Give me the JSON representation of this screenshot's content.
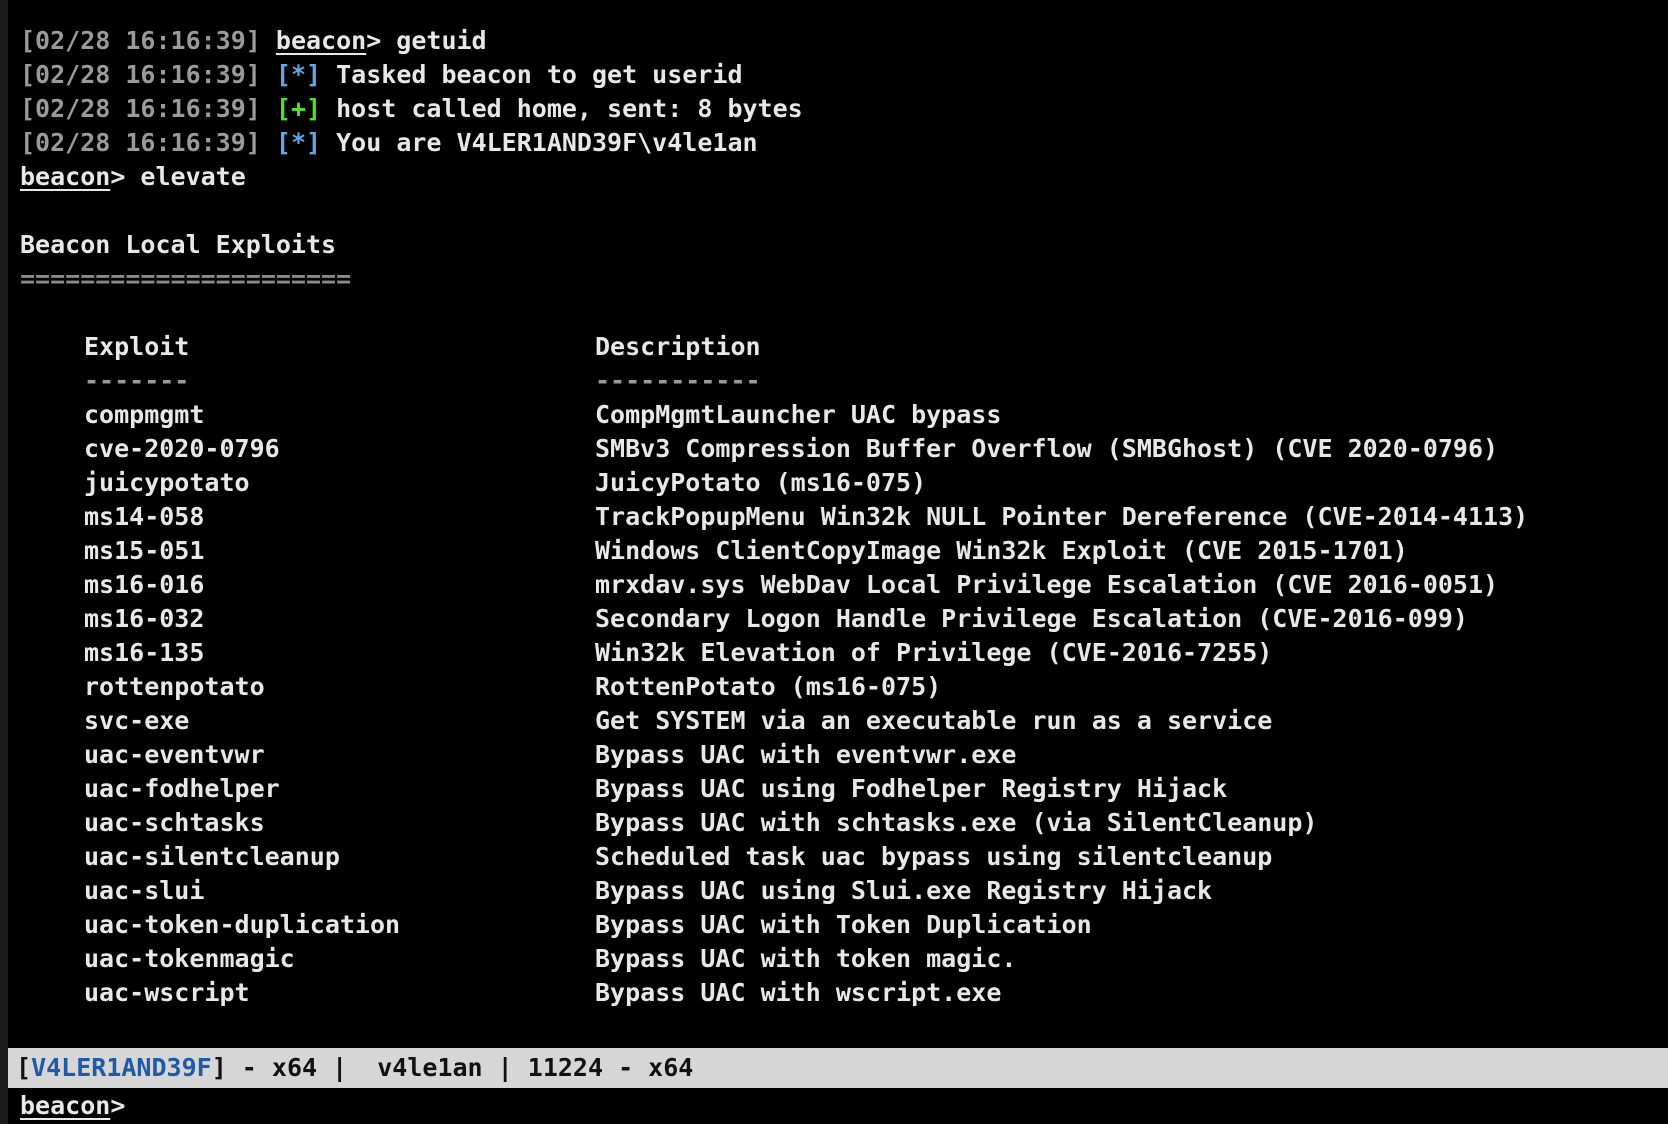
{
  "colors": {
    "background": "#000000",
    "text": "#e8e8e8",
    "timestamp": "#9a9a9a",
    "info_marker": "#5fa8e8",
    "success_marker": "#4fe02a",
    "status_bar_bg": "#d6d6d6",
    "status_host": "#1e5aa8"
  },
  "log": [
    {
      "ts": "[02/28 16:16:39]",
      "marker": "",
      "prompt": "beacon",
      "text": "> getuid"
    },
    {
      "ts": "[02/28 16:16:39]",
      "marker": "[*]",
      "marker_type": "info",
      "text": "Tasked beacon to get userid"
    },
    {
      "ts": "[02/28 16:16:39]",
      "marker": "[+]",
      "marker_type": "ok",
      "text": "host called home, sent: 8 bytes"
    },
    {
      "ts": "[02/28 16:16:39]",
      "marker": "[*]",
      "marker_type": "info",
      "text": "You are V4LER1AND39F\\v4le1an"
    }
  ],
  "command": {
    "prompt": "beacon",
    "text": "> elevate"
  },
  "section": {
    "title": "Beacon Local Exploits",
    "underline": "======================"
  },
  "table": {
    "headers": {
      "exploit": "Exploit",
      "exploit_rule": "-------",
      "description": "Description",
      "description_rule": "-----------"
    },
    "rows": [
      {
        "exploit": "compmgmt",
        "description": "CompMgmtLauncher UAC bypass"
      },
      {
        "exploit": "cve-2020-0796",
        "description": "SMBv3 Compression Buffer Overflow (SMBGhost) (CVE 2020-0796)"
      },
      {
        "exploit": "juicypotato",
        "description": "JuicyPotato (ms16-075)"
      },
      {
        "exploit": "ms14-058",
        "description": "TrackPopupMenu Win32k NULL Pointer Dereference (CVE-2014-4113)"
      },
      {
        "exploit": "ms15-051",
        "description": "Windows ClientCopyImage Win32k Exploit (CVE 2015-1701)"
      },
      {
        "exploit": "ms16-016",
        "description": "mrxdav.sys WebDav Local Privilege Escalation (CVE 2016-0051)"
      },
      {
        "exploit": "ms16-032",
        "description": "Secondary Logon Handle Privilege Escalation (CVE-2016-099)"
      },
      {
        "exploit": "ms16-135",
        "description": "Win32k Elevation of Privilege (CVE-2016-7255)"
      },
      {
        "exploit": "rottenpotato",
        "description": "RottenPotato (ms16-075)"
      },
      {
        "exploit": "svc-exe",
        "description": "Get SYSTEM via an executable run as a service"
      },
      {
        "exploit": "uac-eventvwr",
        "description": "Bypass UAC with eventvwr.exe"
      },
      {
        "exploit": "uac-fodhelper",
        "description": "Bypass UAC using Fodhelper Registry Hijack"
      },
      {
        "exploit": "uac-schtasks",
        "description": "Bypass UAC with schtasks.exe (via SilentCleanup)"
      },
      {
        "exploit": "uac-silentcleanup",
        "description": "Scheduled task uac bypass using silentcleanup"
      },
      {
        "exploit": "uac-slui",
        "description": "Bypass UAC using Slui.exe Registry Hijack"
      },
      {
        "exploit": "uac-token-duplication",
        "description": "Bypass UAC with Token Duplication"
      },
      {
        "exploit": "uac-tokenmagic",
        "description": "Bypass UAC with token magic."
      },
      {
        "exploit": "uac-wscript",
        "description": "Bypass UAC with wscript.exe"
      }
    ]
  },
  "status_bar": {
    "open_bracket": "[",
    "host": "V4LER1AND39F",
    "rest": "] - x64 |  v4le1an | 11224 - x64"
  },
  "input": {
    "prompt": "beacon",
    "suffix": ">",
    "value": ""
  }
}
